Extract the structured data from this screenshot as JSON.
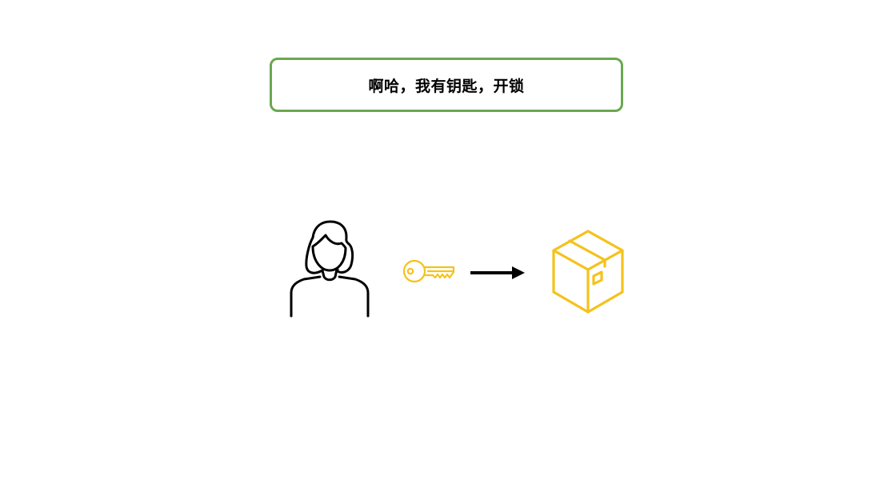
{
  "speech": {
    "text": "啊哈，我有钥匙，开锁"
  },
  "icons": {
    "person": "woman-person-icon",
    "key": "key-icon",
    "arrow": "right-arrow-icon",
    "box": "package-box-icon"
  },
  "colors": {
    "box_border": "#6aa84f",
    "accent_yellow": "#f5c21b",
    "stroke_dark": "#000000"
  }
}
